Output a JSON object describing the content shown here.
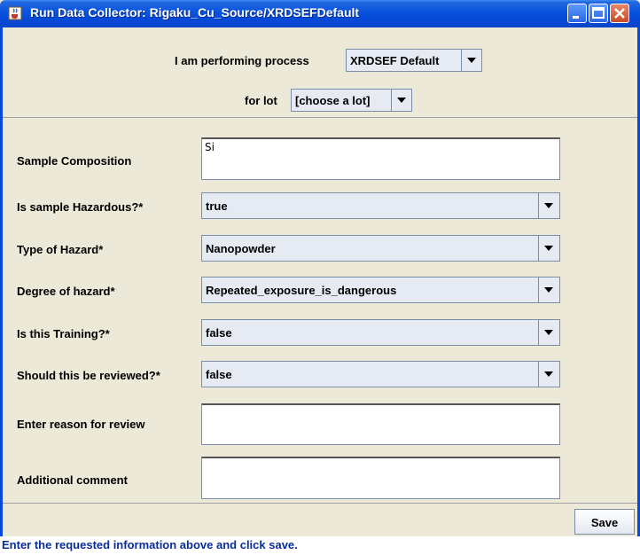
{
  "window": {
    "title": "Run Data Collector: Rigaku_Cu_Source/XRDSEFDefault"
  },
  "header": {
    "process_label": "I am performing process",
    "process_value": "XRDSEF Default",
    "lot_label": "for lot",
    "lot_value": "[choose a lot]"
  },
  "form": {
    "sample_composition": {
      "label": "Sample Composition",
      "value": "Si"
    },
    "hazardous": {
      "label": "Is sample Hazardous?*",
      "value": "true"
    },
    "hazard_type": {
      "label": "Type of Hazard*",
      "value": "Nanopowder"
    },
    "hazard_degree": {
      "label": "Degree of hazard*",
      "value": "Repeated_exposure_is_dangerous"
    },
    "training": {
      "label": "Is this Training?*",
      "value": "false"
    },
    "review": {
      "label": "Should this be reviewed?*",
      "value": "false"
    },
    "review_reason": {
      "label": "Enter reason for review",
      "value": ""
    },
    "comment": {
      "label": "Additional comment",
      "value": ""
    }
  },
  "footer": {
    "save_label": "Save"
  },
  "status": {
    "message": "Enter the requested information above and click save."
  },
  "colors": {
    "titlebar": "#0a55e0",
    "status_text": "#0a2d9a",
    "window_bg": "#ece9d8"
  },
  "icons": [
    "java-cup-icon",
    "minimize-icon",
    "maximize-icon",
    "close-icon",
    "chevron-down-icon"
  ]
}
